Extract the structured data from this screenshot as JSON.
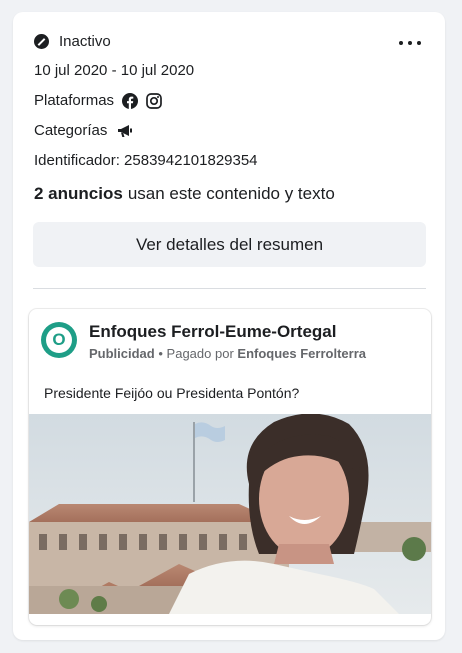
{
  "summary": {
    "status": "Inactivo",
    "date_range": "10 jul 2020 - 10 jul 2020",
    "platforms_label": "Plataformas",
    "platform_icons": [
      "facebook-icon",
      "instagram-icon"
    ],
    "categories_label": "Categorías",
    "category_icons": [
      "megaphone-icon"
    ],
    "identifier": "Identificador: 2583942101829354",
    "ads_count": "2 anuncios",
    "ads_count_suffix": "usan este contenido y texto",
    "details_button": "Ver detalles del resumen"
  },
  "ad": {
    "page_name": "Enfoques Ferrol-Eume-Ortegal",
    "avatar_letter": "O",
    "sponsored_label": "Publicidad",
    "separator": "•",
    "paid_by_prefix": "Pagado por",
    "paid_by_name": "Enfoques Ferrolterra",
    "body_text": "Presidente Feijóo ou Presidenta Pontón?"
  },
  "colors": {
    "avatar": "#1e9e87",
    "background": "#f0f2f5",
    "button": "#f0f2f5"
  }
}
